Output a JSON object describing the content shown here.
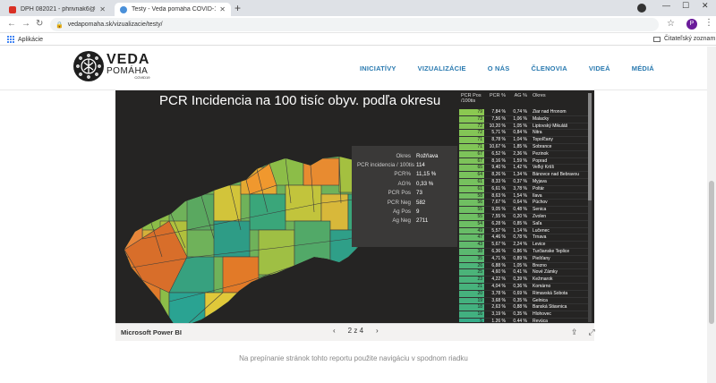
{
  "browser": {
    "tabs": [
      {
        "label": "DPH 082021 - phrivnak6@gmail.c",
        "active": false
      },
      {
        "label": "Testy - Veda pomáha COVID-19",
        "active": true
      }
    ],
    "url": "vedapomaha.sk/vizualizacie/testy/",
    "bookmarks_label": "Aplikácie",
    "reading_list": "Čitateľský zoznam",
    "profile_initial": "P"
  },
  "site": {
    "logo": {
      "line1": "VEDA",
      "line2": "POMÁHA",
      "line3": "COVID19"
    },
    "nav": [
      "INICIATÍVY",
      "VIZUALIZÁCIE",
      "O NÁS",
      "ČLENOVIA",
      "VIDEÁ",
      "MÉDIÁ"
    ],
    "hint": "Na prepínanie stránok tohto reportu použite navigáciu v spodnom riadku"
  },
  "report": {
    "title": "PCR Incidencia na 100 tisíc obyv. podľa okresu",
    "tooltip": [
      {
        "k": "Okres",
        "v": "Rožňava"
      },
      {
        "k": "PCR incidencia / 100tis",
        "v": "114"
      },
      {
        "k": "PCR%",
        "v": "11,15 %"
      },
      {
        "k": "AG%",
        "v": "0,33 %"
      },
      {
        "k": "PCR Pos",
        "v": "73"
      },
      {
        "k": "PCR Neg",
        "v": "582"
      },
      {
        "k": "Ag Pos",
        "v": "9"
      },
      {
        "k": "Ag Neg",
        "v": "2711"
      }
    ],
    "table": {
      "headers": [
        "PCR Pos /100tis",
        "PCR %",
        "AG %",
        "Okres"
      ],
      "rows": [
        [
          "79",
          "7,84 %",
          "0,74 %",
          "Žiar nad Hronom"
        ],
        [
          "73",
          "7,56 %",
          "1,06 %",
          "Malacky"
        ],
        [
          "72",
          "10,20 %",
          "1,05 %",
          "Liptovský Mikuláš"
        ],
        [
          "72",
          "5,71 %",
          "0,84 %",
          "Nitra"
        ],
        [
          "71",
          "8,78 %",
          "1,04 %",
          "Topoľčany"
        ],
        [
          "71",
          "10,67 %",
          "1,85 %",
          "Sobrance"
        ],
        [
          "67",
          "6,52 %",
          "2,36 %",
          "Pezinok"
        ],
        [
          "67",
          "8,16 %",
          "1,59 %",
          "Poprad"
        ],
        [
          "65",
          "9,40 %",
          "1,42 %",
          "Veľký Krtíš"
        ],
        [
          "64",
          "8,26 %",
          "1,34 %",
          "Bánovce nad Bebravou"
        ],
        [
          "61",
          "8,33 %",
          "0,37 %",
          "Myjava"
        ],
        [
          "61",
          "6,61 %",
          "3,78 %",
          "Poltár"
        ],
        [
          "58",
          "8,63 %",
          "1,54 %",
          "Ilava"
        ],
        [
          "56",
          "7,67 %",
          "0,64 %",
          "Púchov"
        ],
        [
          "55",
          "9,05 %",
          "0,48 %",
          "Senica"
        ],
        [
          "55",
          "7,55 %",
          "0,20 %",
          "Zvolen"
        ],
        [
          "54",
          "6,28 %",
          "0,85 %",
          "Šaľa"
        ],
        [
          "49",
          "5,57 %",
          "1,14 %",
          "Lučenec"
        ],
        [
          "47",
          "4,46 %",
          "0,78 %",
          "Trnava"
        ],
        [
          "43",
          "5,67 %",
          "2,24 %",
          "Levice"
        ],
        [
          "38",
          "6,36 %",
          "0,86 %",
          "Turčianske Teplice"
        ],
        [
          "35",
          "4,71 %",
          "0,89 %",
          "Piešťany"
        ],
        [
          "26",
          "6,88 %",
          "1,05 %",
          "Brezno"
        ],
        [
          "25",
          "4,60 %",
          "0,41 %",
          "Nové Zámky"
        ],
        [
          "23",
          "4,22 %",
          "0,39 %",
          "Kežmarok"
        ],
        [
          "21",
          "4,04 %",
          "0,36 %",
          "Komárno"
        ],
        [
          "20",
          "3,78 %",
          "0,69 %",
          "Rimavská Sobota"
        ],
        [
          "19",
          "3,68 %",
          "0,35 %",
          "Gelnica"
        ],
        [
          "18",
          "2,63 %",
          "0,88 %",
          "Banská Štiavnica"
        ],
        [
          "16",
          "3,19 %",
          "0,35 %",
          "Hlohovec"
        ],
        [
          "5",
          "1,26 %",
          "0,44 %",
          "Revúca"
        ]
      ]
    },
    "footer": {
      "label": "Microsoft Power BI",
      "pager": "2 z 4"
    }
  }
}
